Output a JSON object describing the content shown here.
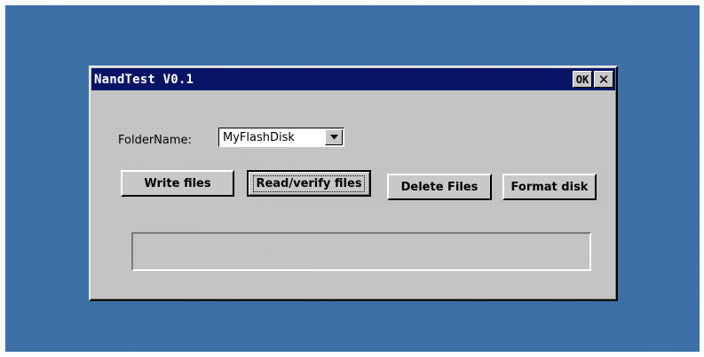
{
  "window": {
    "title": "NandTest V0.1",
    "ok_label": "OK",
    "close_glyph": "✕"
  },
  "folder": {
    "label": "FolderName:",
    "selected": "MyFlashDisk"
  },
  "buttons": {
    "write": "Write files",
    "read": "Read/verify files",
    "delete": "Delete Files",
    "format": "Format disk"
  },
  "status": {
    "text": ""
  },
  "colors": {
    "desktop": "#3b6ea5",
    "titlebar": "#0a1466",
    "window": "#c2c2c2"
  }
}
